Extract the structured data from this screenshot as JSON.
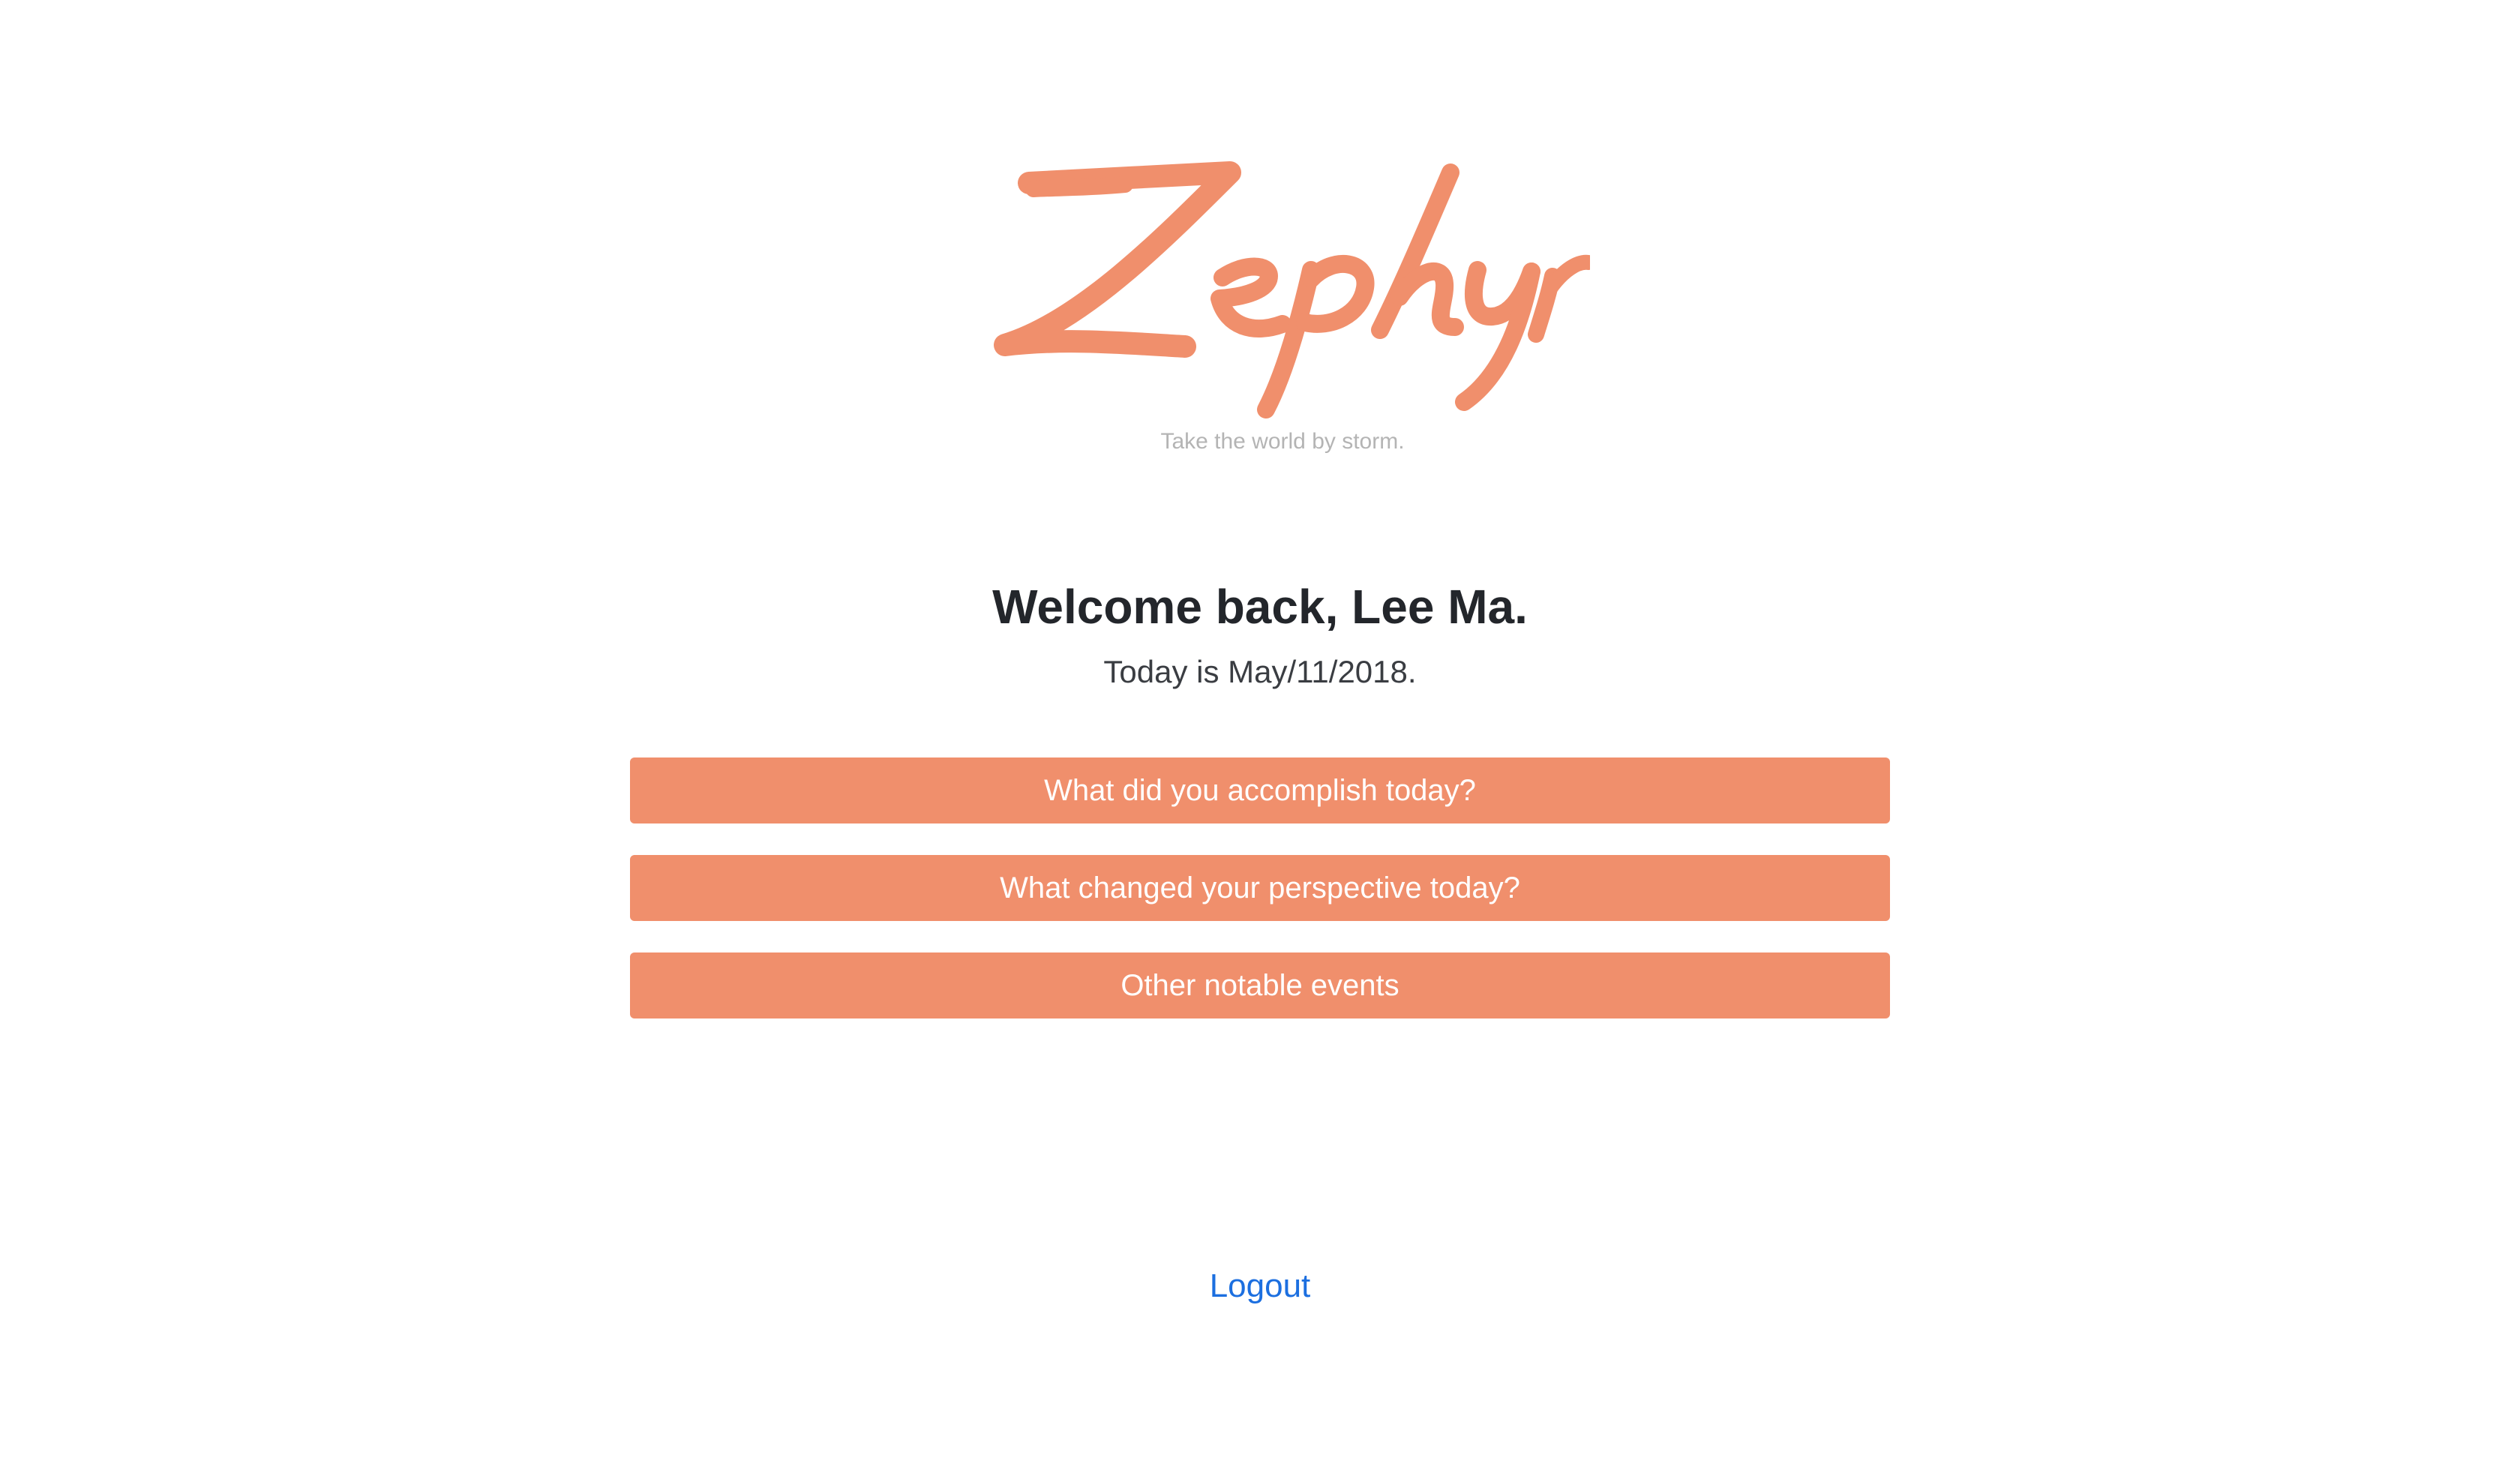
{
  "brand": {
    "logo_text": "Zephyr",
    "tagline": "Take the world by storm.",
    "accent_color": "#f08f6c"
  },
  "greeting": {
    "welcome": "Welcome back, Lee Ma.",
    "date_text": "Today is May/11/2018."
  },
  "prompts": [
    {
      "label": "What did you accomplish today?"
    },
    {
      "label": "What changed your perspective today?"
    },
    {
      "label": "Other notable events"
    }
  ],
  "footer": {
    "logout_label": "Logout",
    "link_color": "#1c6fe0"
  }
}
